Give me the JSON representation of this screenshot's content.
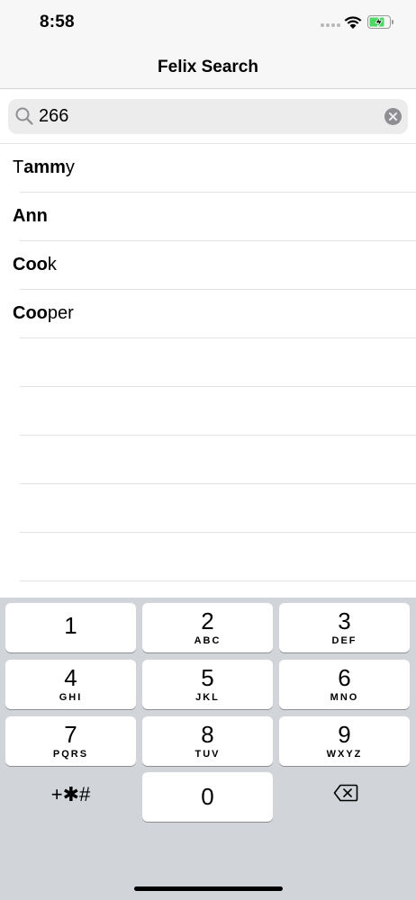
{
  "status": {
    "time": "8:58"
  },
  "nav": {
    "title": "Felix Search"
  },
  "search": {
    "value": "266",
    "placeholder": ""
  },
  "results": [
    {
      "bold": "T",
      "rest": "ammy",
      "match": "amm"
    },
    {
      "bold": "Ann",
      "rest": ""
    },
    {
      "bold": "Coo",
      "rest": "k"
    },
    {
      "bold": "Coo",
      "rest": "per"
    }
  ],
  "keyboard": {
    "keys": [
      {
        "digit": "1",
        "letters": ""
      },
      {
        "digit": "2",
        "letters": "ABC"
      },
      {
        "digit": "3",
        "letters": "DEF"
      },
      {
        "digit": "4",
        "letters": "GHI"
      },
      {
        "digit": "5",
        "letters": "JKL"
      },
      {
        "digit": "6",
        "letters": "MNO"
      },
      {
        "digit": "7",
        "letters": "PQRS"
      },
      {
        "digit": "8",
        "letters": "TUV"
      },
      {
        "digit": "9",
        "letters": "WXYZ"
      }
    ],
    "symbols": "+✱#",
    "zero": "0"
  },
  "icons": {
    "search": "search-icon",
    "clear": "clear-icon",
    "delete": "delete-icon",
    "wifi": "wifi-icon",
    "battery": "battery-charging-icon"
  },
  "colors": {
    "battery": "#4cd964",
    "keyboard_bg": "#d1d4d9"
  }
}
